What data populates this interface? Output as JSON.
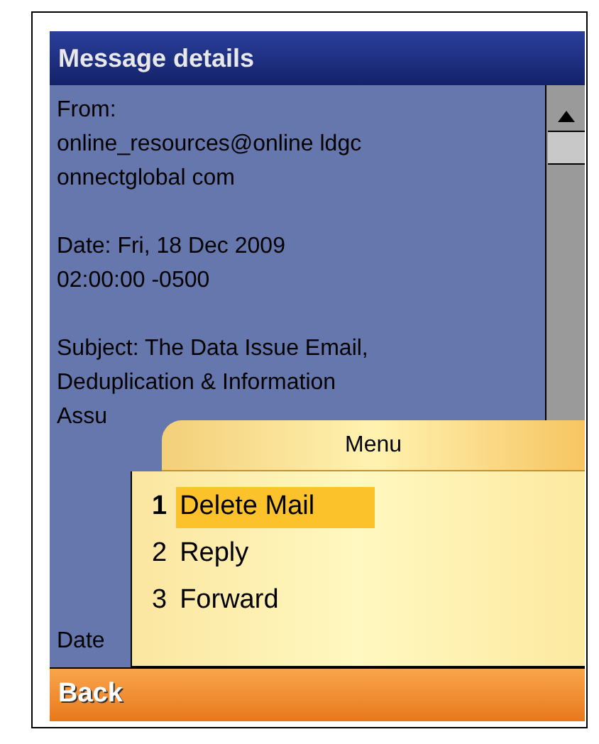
{
  "window": {
    "title": "Message details"
  },
  "message_paragraphs": [
    [
      "From:",
      "online_resources@online ldgc",
      "onnectglobal com"
    ],
    [
      "Date: Fri, 18 Dec 2009",
      "02:00:00 -0500"
    ],
    [
      "Subject: The Data Issue Email,",
      "Deduplication & Information",
      "Assu"
    ],
    [
      "Date"
    ]
  ],
  "menu": {
    "title": "Menu",
    "items": [
      {
        "number": "1",
        "label": "Delete Mail",
        "selected": true
      },
      {
        "number": "2",
        "label": "Reply",
        "selected": false
      },
      {
        "number": "3",
        "label": "Forward",
        "selected": false
      }
    ]
  },
  "softkey": {
    "label": "Back"
  }
}
